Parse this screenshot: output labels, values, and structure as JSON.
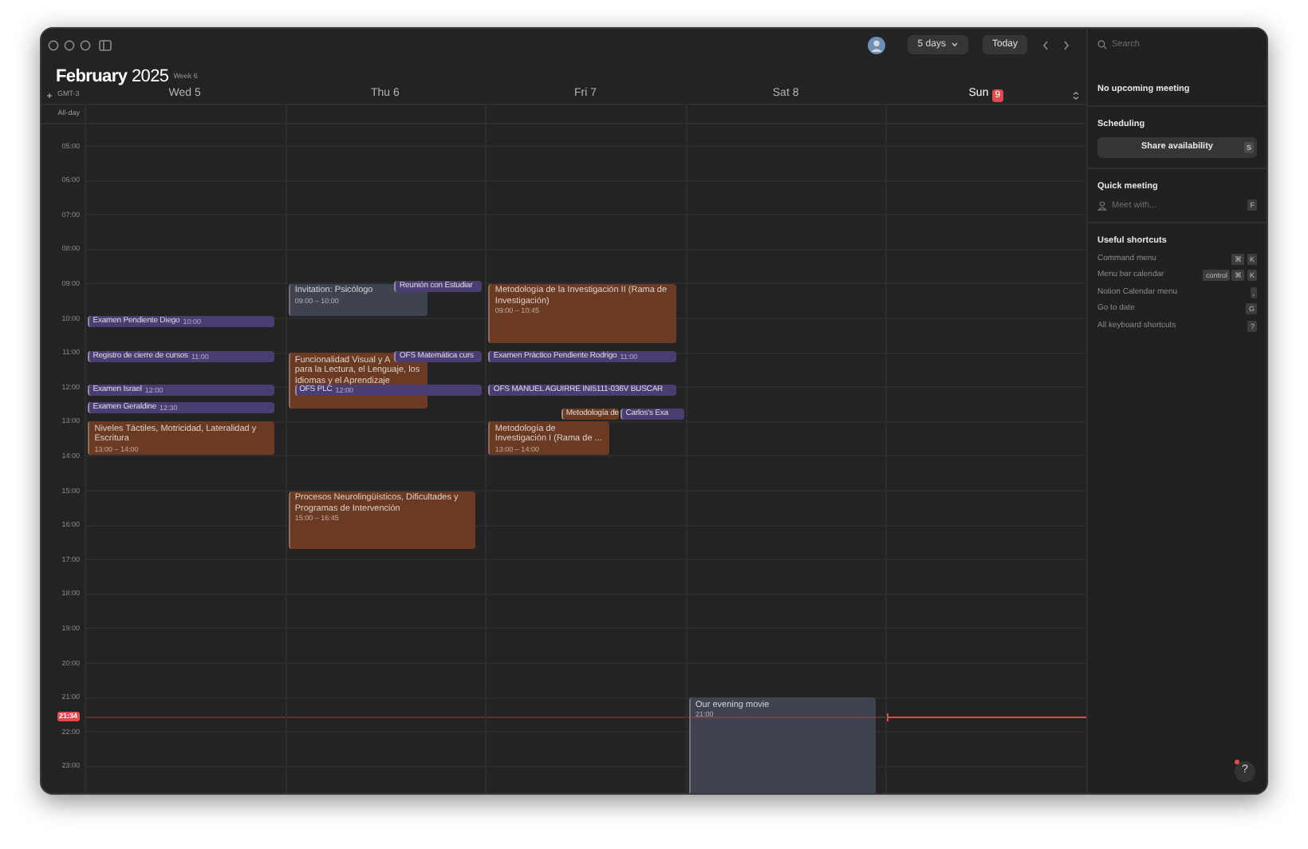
{
  "toolbar": {
    "view": "5 days",
    "today": "Today"
  },
  "title": {
    "month": "February",
    "year": "2025",
    "week": "Week 6"
  },
  "timezone": "GMT-3",
  "all_day_label": "All-day",
  "hours": [
    "05:00",
    "06:00",
    "07:00",
    "08:00",
    "09:00",
    "10:00",
    "11:00",
    "12:00",
    "13:00",
    "14:00",
    "15:00",
    "16:00",
    "17:00",
    "18:00",
    "19:00",
    "20:00",
    "21:00",
    "22:00",
    "23:00"
  ],
  "now": "21:34",
  "days": [
    {
      "weekday": "Wed",
      "date": "5",
      "today": false,
      "events": [
        {
          "kind": "bar",
          "title": "Examen Pendiente Diego",
          "time": "10:00",
          "color": "#4a3d72"
        },
        {
          "kind": "bar",
          "title": "Registro de cierre de cursos",
          "time": "11:00",
          "color": "#4a3d72"
        },
        {
          "kind": "bar",
          "title": "Examen Israel",
          "time": "12:00",
          "color": "#4a3d72"
        },
        {
          "kind": "bar",
          "title": "Examen Geraldine",
          "time": "12:30",
          "color": "#4a3d72"
        },
        {
          "kind": "block",
          "title": "Niveles Táctiles, Motricidad, Lateralidad y Escritura",
          "time": "13:00 – 14:00",
          "color": "#6b3a22"
        }
      ]
    },
    {
      "weekday": "Thu",
      "date": "6",
      "today": false,
      "events": [
        {
          "kind": "block",
          "title": "Invitation: Psicólogo",
          "time": "09:00 – 10:00",
          "color": "#3f4350"
        },
        {
          "kind": "bar",
          "title": "Reunión con Estudiar",
          "color": "#4a3d72"
        },
        {
          "kind": "block",
          "title": "Funcionalidad Visual y A\npara la Lectura, el Lenguaje, los Idiomas y el Aprendizaje",
          "color": "#6b3a22"
        },
        {
          "kind": "bar",
          "title": "OFS Matemática curs",
          "color": "#4a3d72"
        },
        {
          "kind": "bar",
          "title": "OFS PLC",
          "time": "12:00",
          "color": "#4a3d72"
        },
        {
          "kind": "block",
          "title": "Procesos Neurolingüísticos, Dificultades y Programas de Intervención",
          "time": "15:00 – 16:45",
          "color": "#6b3a22"
        }
      ]
    },
    {
      "weekday": "Fri",
      "date": "7",
      "today": false,
      "events": [
        {
          "kind": "block",
          "title": "Metodología de la Investigación II (Rama de Investigación)",
          "time": "09:00 – 10:45",
          "color": "#6b3a22"
        },
        {
          "kind": "bar",
          "title": "Examen Práctico Pendiente Rodrigo",
          "time": "11:00",
          "color": "#4a3d72"
        },
        {
          "kind": "bar",
          "title": "OFS MANUEL AGUIRRE INI5111-036V BUSCAR",
          "color": "#4a3d72"
        },
        {
          "kind": "bar",
          "title": "Metodología de",
          "color": "#6b3a22"
        },
        {
          "kind": "bar",
          "title": "Carlos's Exa",
          "color": "#4a3d72"
        },
        {
          "kind": "block",
          "title": "Metodología de\nInvestigación I (Rama de ...",
          "time": "13:00 – 14:00",
          "color": "#6b3a22"
        }
      ]
    },
    {
      "weekday": "Sat",
      "date": "8",
      "today": false,
      "events": [
        {
          "kind": "block",
          "title": "Our evening movie",
          "time": "21:00",
          "color": "#3f4350"
        }
      ]
    },
    {
      "weekday": "Sun",
      "date": "9",
      "today": true
    }
  ],
  "sidebar": {
    "search_placeholder": "Search",
    "upcoming": "No upcoming meeting",
    "scheduling": {
      "heading": "Scheduling",
      "button": "Share availability",
      "key": "S"
    },
    "quick_meeting": {
      "heading": "Quick meeting",
      "placeholder": "Meet with...",
      "key": "F"
    },
    "shortcuts": {
      "heading": "Useful shortcuts",
      "items": [
        {
          "label": "Command menu",
          "keys": [
            "⌘",
            "K"
          ]
        },
        {
          "label": "Menu bar calendar",
          "keys": [
            "control",
            "⌘",
            "K"
          ]
        },
        {
          "label": "Notion Calendar menu",
          "keys": [
            ","
          ]
        },
        {
          "label": "Go to date",
          "keys": [
            "G"
          ]
        },
        {
          "label": "All keyboard shortcuts",
          "keys": [
            "?"
          ]
        }
      ]
    }
  },
  "help": "?"
}
